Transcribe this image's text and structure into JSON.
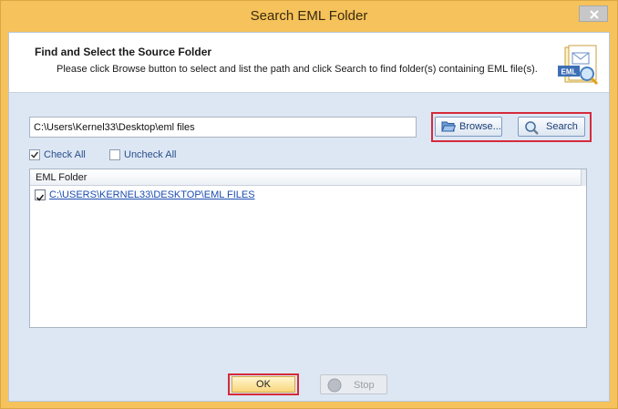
{
  "window": {
    "title": "Search EML Folder"
  },
  "header": {
    "title": "Find and Select the Source Folder",
    "description": "Please click Browse button to select and list the path and click Search to find folder(s) containing EML file(s).",
    "icon_label": "EML"
  },
  "path": {
    "value": "C:\\Users\\Kernel33\\Desktop\\eml files"
  },
  "toolbar": {
    "browse_label": "Browse...",
    "search_label": "Search"
  },
  "selection": {
    "check_all_label": "Check All",
    "uncheck_all_label": "Uncheck All"
  },
  "list": {
    "column_header": "EML Folder",
    "rows": [
      {
        "path": "C:\\USERS\\KERNEL33\\DESKTOP\\EML FILES",
        "checked": true
      }
    ]
  },
  "footer": {
    "ok_label": "OK",
    "stop_label": "Stop"
  },
  "colors": {
    "frame": "#f5c25b",
    "client": "#dde7f4",
    "highlight": "#d62a3a",
    "link": "#1a4cb0"
  }
}
